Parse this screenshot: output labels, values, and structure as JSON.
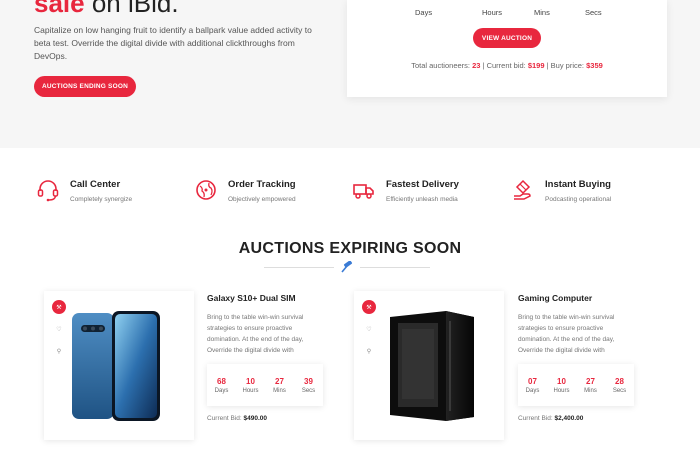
{
  "hero": {
    "title_accent": "sale",
    "title_rest": " on iBid.",
    "description": "Capitalize on low hanging fruit to identify a ballpark value added activity to beta test. Override the digital divide with additional clickthroughs from DevOps.",
    "button_label": "AUCTIONS ENDING SOON"
  },
  "auction_card": {
    "countdown_labels": [
      "Days",
      "Hours",
      "Mins",
      "Secs"
    ],
    "button_label": "VIEW AUCTION",
    "total_label": "Total auctioneers:",
    "total_value": "23",
    "current_label": "| Current bid:",
    "current_value": "$199",
    "buy_label": "| Buy price:",
    "buy_value": "$359"
  },
  "features": [
    {
      "title": "Call Center",
      "subtitle": "Completely synergize",
      "icon": "headset-icon"
    },
    {
      "title": "Order Tracking",
      "subtitle": "Objectively empowered",
      "icon": "globe-icon"
    },
    {
      "title": "Fastest Delivery",
      "subtitle": "Efficiently unleash media",
      "icon": "truck-icon"
    },
    {
      "title": "Instant Buying",
      "subtitle": "Podcasting operational",
      "icon": "hand-icon"
    }
  ],
  "section": {
    "title": "AUCTIONS EXPIRING SOON"
  },
  "products": [
    {
      "title": "Galaxy S10+ Dual SIM",
      "description": "Bring to the table win-win survival strategies to ensure proactive domination. At the end of the day, Override the digital divide with",
      "countdown": [
        {
          "num": "68",
          "unit": "Days"
        },
        {
          "num": "10",
          "unit": "Hours"
        },
        {
          "num": "27",
          "unit": "Mins"
        },
        {
          "num": "39",
          "unit": "Secs"
        }
      ],
      "bid_label": "Current Bid:",
      "bid_value": "$490.00"
    },
    {
      "title": "Gaming Computer",
      "description": "Bring to the table win-win survival strategies to ensure proactive domination. At the end of the day, Override the digital divide with",
      "countdown": [
        {
          "num": "07",
          "unit": "Days"
        },
        {
          "num": "10",
          "unit": "Hours"
        },
        {
          "num": "27",
          "unit": "Mins"
        },
        {
          "num": "28",
          "unit": "Secs"
        }
      ],
      "bid_label": "Current Bid:",
      "bid_value": "$2,400.00"
    }
  ],
  "colors": {
    "accent": "#e8273e",
    "hero_bg": "#f6f6f6"
  }
}
